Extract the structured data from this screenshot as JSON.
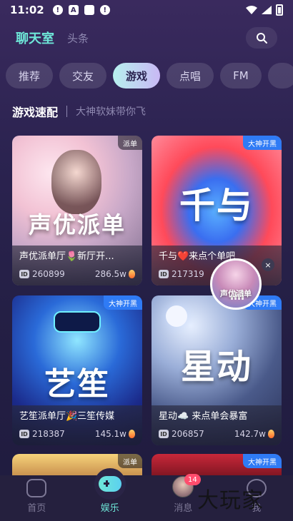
{
  "status_bar": {
    "time": "11:02",
    "icons_left": [
      "alert-icon",
      "a-icon",
      "square-icon",
      "alert-icon"
    ],
    "icons_right": [
      "wifi-icon",
      "signal-icon",
      "battery-icon"
    ]
  },
  "header": {
    "active_tab": "聊天室",
    "tab2": "头条",
    "search_icon": "search-icon",
    "accent_color": "#6ee7d8"
  },
  "chips": [
    "推荐",
    "交友",
    "游戏",
    "点唱",
    "FM"
  ],
  "active_chip": "游戏",
  "section": {
    "title": "游戏速配",
    "subtitle": "大神软妹带你飞"
  },
  "cards": [
    {
      "tag": "派单",
      "art_text": "声优派单",
      "name": "声优派单厅🌷新厅开...",
      "id": "260899",
      "hot": "286.5w"
    },
    {
      "tag": "大神开黑",
      "art_text": "千与",
      "name": "千与❤️来点个单吧",
      "id": "217319",
      "hot": ""
    },
    {
      "tag": "大神开黑",
      "art_text": "艺笙",
      "name": "艺笙派单厅🎉三笙传媒",
      "id": "218387",
      "hot": "145.1w"
    },
    {
      "tag": "大神开黑",
      "art_text": "星动",
      "name": "星动☁️ 来点单会暴富",
      "id": "206857",
      "hot": "142.7w"
    }
  ],
  "partial_cards": [
    {
      "tag": "派单"
    },
    {
      "tag": "大神开黑"
    }
  ],
  "floating_room": {
    "label": "声优派单",
    "close": "×"
  },
  "id_badge": "ID",
  "bottom_nav": [
    {
      "label": "首页",
      "icon": "home-icon"
    },
    {
      "label": "娱乐",
      "icon": "gamepad-icon"
    },
    {
      "label": "消息",
      "icon": "avatar-icon",
      "badge": "14"
    },
    {
      "label": "我",
      "icon": "user-icon"
    }
  ],
  "watermark": "大玩家"
}
